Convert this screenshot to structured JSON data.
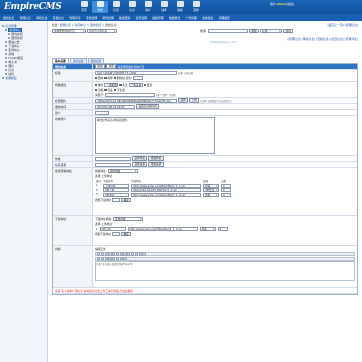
{
  "header": {
    "logo_main": "EmpireCMS",
    "nav": [
      "首页",
      "系统",
      "栏目",
      "信息",
      "用户",
      "插件",
      "模板",
      "其他"
    ],
    "user_label": "用户:",
    "user_name": "admin",
    "user_suffix": "[退出]"
  },
  "menubar": [
    "增加信息",
    "管理信息",
    "审核信息",
    "签发信息",
    "管理评论",
    "专题管理",
    "附件管理",
    "数据更新",
    "标签管理",
    "模板管理",
    "数据整合",
    "广告管理",
    "友情链接",
    "清理缓存"
  ],
  "sidebar": {
    "items": [
      {
        "label": "信息管理",
        "level": 0,
        "state": "blue"
      },
      {
        "label": "新闻中心",
        "level": 1,
        "state": "sel"
      },
      {
        "label": "国内新闻",
        "level": 2,
        "state": ""
      },
      {
        "label": "国际新闻",
        "level": 2,
        "state": ""
      },
      {
        "label": "网站公告",
        "level": 1,
        "state": ""
      },
      {
        "label": "下载中心",
        "level": 1,
        "state": ""
      },
      {
        "label": "影视中心",
        "level": 1,
        "state": ""
      },
      {
        "label": "商城",
        "level": 1,
        "state": ""
      },
      {
        "label": "FLASH频道",
        "level": 1,
        "state": ""
      },
      {
        "label": "电子书",
        "level": 1,
        "state": ""
      },
      {
        "label": "图片",
        "level": 1,
        "state": ""
      },
      {
        "label": "信息",
        "level": 1,
        "state": ""
      },
      {
        "label": "插件",
        "level": 1,
        "state": ""
      },
      {
        "label": "系统模型",
        "level": 1,
        "state": ""
      }
    ]
  },
  "main": {
    "breadcrumb_prefix": "位置:",
    "breadcrumb": [
      "管理信息",
      "新闻中心",
      "国内新闻",
      "增加信息"
    ],
    "top_links": "[返回上一页] [管理信息]",
    "filter_select": "选择要管理的栏目",
    "filter_select2": "该栏目下的信息",
    "search_label": "搜索:",
    "search_button": "搜索",
    "search_option": "标题",
    "search_button2": "显示",
    "top_links2": "[管理信息] [审核信息] [归档信息] [栏目信息] [管理评论]",
    "watermark": "www.sudayn.com",
    "tabs": [
      "基本设置",
      "选项设置",
      "权限设置"
    ],
    "form": {
      "header_label": "增加信息",
      "header_btn1": "提交",
      "header_btn2": "重置",
      "header_note": "请选择增加信息的栏目",
      "rows": {
        "title_label": "标题",
        "title_value": "演示下载系统:帝国CMS7.5下载站",
        "title_note": "标题 | 副标题",
        "title_options": [
          "粗体",
          "斜体",
          "删除线",
          "颜色:"
        ],
        "property_label": "特殊属性",
        "property_line1": [
          "推荐",
          "头条",
          "置顶",
          "审核",
          "签发",
          "不生成",
          "关键字"
        ],
        "property_level": "一级推荐",
        "property_head": "一级头条",
        "keywords_label": "关键字:",
        "keywords_note": "(多个请用\",\"格开)",
        "url_label": "标题图片",
        "url_value": "/d/file/2014-01-08/4f4b08869b0bf9f6fda07770e6d7b.jpg",
        "url_btn1": "选择",
        "url_btn2": "上传",
        "url_note": "(说明: 选择图片后自动显示)",
        "time_label": "发布时间",
        "time_value": "2014-01-08 14:00:47",
        "time_btn": "设置为当前时间",
        "intro_label": "简介",
        "content_label": "内容简介",
        "content_text": "本文仅作演示(非真实软件)",
        "author_label": "作者",
        "author_btn1": "选择作者",
        "author_btn2": "增加作者",
        "source_label": "信息来源",
        "source_btn1": "选择来源",
        "source_btn2": "增加来源",
        "online_label": "在线观看地址",
        "online_group_prefix": "前缀地址:",
        "online_group_select": "选择前缀",
        "online_table_caption": "选择:上传地址",
        "online_cols": [
          "编号",
          "下载名称",
          "下载地址",
          "点数",
          "权限",
          "删除"
        ],
        "online_rows": [
          {
            "no": "1",
            "name": "下载链接",
            "url": "http://www.sohu.com/file/offer/1_1_1.rar",
            "pts": "0",
            "perm": "游客",
            "del": "删除"
          },
          {
            "no": "2",
            "name": "VIP下载",
            "url": "http://126.34.243.189/1/1/1_1.rar",
            "pts": "0",
            "perm": "VIP会员",
            "del": "删除"
          },
          {
            "no": "3",
            "name": "VIP通道",
            "url": "http://www.sohu.com/file/offer/1_1_2.rar",
            "pts": "0",
            "perm": "游客",
            "del": "删除"
          }
        ],
        "online_add": "增加下载地址",
        "online_add_btn": "确定",
        "down_label": "下载地址",
        "down_group_prefix": "下载地址前缀:",
        "down_group_select": "选择前缀",
        "down_table_caption": "选择:上传地址",
        "down_rows": [
          {
            "no": "1",
            "name": "VIP下载",
            "url": "http://www.sohu.com/file/offer/1_1_1.rar",
            "pts": "0",
            "perm": "游客",
            "del": "删除"
          }
        ],
        "down_add": "增加下载地址",
        "down_add_btn": "确定",
        "newstext_label": "内容",
        "editor_label": "编辑正文",
        "editor_note": "注意:可以插入视频/音频/Flash等",
        "bottom_note": "注意:写入版本介绍信息,请将鼠标点击上方工具栏按钮,点击后编辑"
      }
    }
  }
}
